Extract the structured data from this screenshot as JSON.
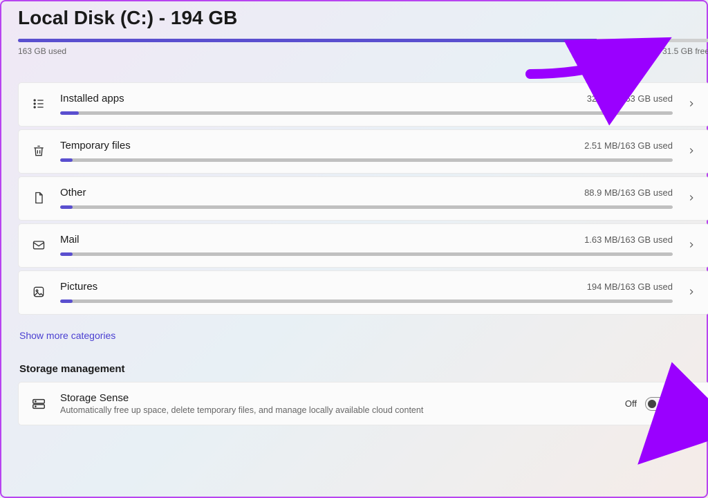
{
  "title": "Local Disk (C:) - 194 GB",
  "disk": {
    "used_label": "163 GB used",
    "free_label": "31.5 GB free",
    "fill_pct": 83.7
  },
  "categories": [
    {
      "key": "installed-apps",
      "icon": "apps",
      "name": "Installed apps",
      "size": "321 MB/163 GB used",
      "fill": 3
    },
    {
      "key": "temp-files",
      "icon": "trash",
      "name": "Temporary files",
      "size": "2.51 MB/163 GB used",
      "fill": 2
    },
    {
      "key": "other",
      "icon": "file",
      "name": "Other",
      "size": "88.9 MB/163 GB used",
      "fill": 2
    },
    {
      "key": "mail",
      "icon": "mail",
      "name": "Mail",
      "size": "1.63 MB/163 GB used",
      "fill": 2
    },
    {
      "key": "pictures",
      "icon": "image",
      "name": "Pictures",
      "size": "194 MB/163 GB used",
      "fill": 2
    }
  ],
  "show_more": "Show more categories",
  "storage_management": {
    "heading": "Storage management",
    "sense": {
      "name": "Storage Sense",
      "desc": "Automatically free up space, delete temporary files, and manage locally available cloud content",
      "state": "Off"
    }
  }
}
